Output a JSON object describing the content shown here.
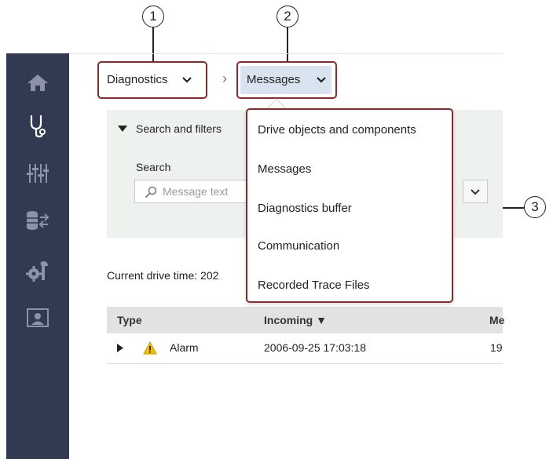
{
  "callouts": [
    "1",
    "2",
    "3"
  ],
  "breadcrumb": {
    "item1": "Diagnostics",
    "separator": "›",
    "item2": "Messages"
  },
  "nav_icons": [
    "home-icon",
    "stethoscope-icon",
    "sliders-icon",
    "database-transfer-icon",
    "gear-wrench-icon",
    "user-screen-icon"
  ],
  "search_panel": {
    "toggle_label": "Search and filters",
    "search_label": "Search",
    "search_placeholder": "Message text"
  },
  "dropdown": {
    "items": [
      "Drive objects and components",
      "Messages",
      "Diagnostics buffer",
      "Communication",
      "Recorded Trace Files"
    ]
  },
  "status": {
    "drive_time_label": "Current drive time: 202"
  },
  "table": {
    "headers": [
      "Type",
      "Incoming ▼",
      "Me"
    ],
    "rows": [
      {
        "type": "Alarm",
        "incoming": "2006-09-25 17:03:18",
        "message": "19"
      }
    ]
  },
  "colors": {
    "rail": "#323a52",
    "callout_border": "#8b2a2a",
    "breadcrumb_active_bg": "#d9e4f0",
    "panel_bg": "#eef2ef",
    "alarm_yellow": "#f2c200"
  }
}
